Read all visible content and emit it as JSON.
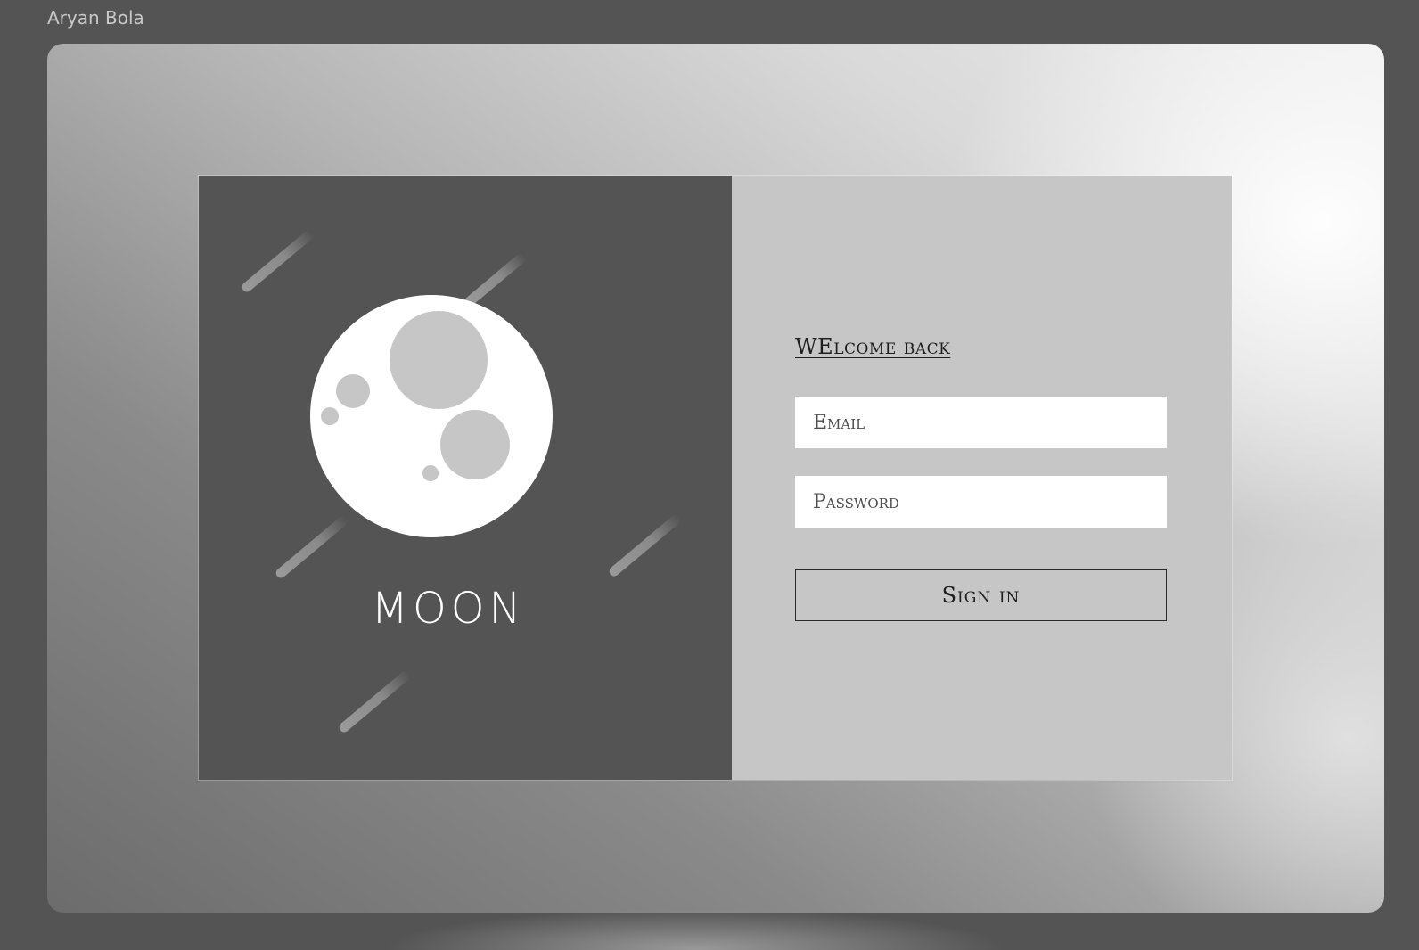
{
  "canvas": {
    "frame_label": "Aryan Bola"
  },
  "brand": {
    "title": "MOON"
  },
  "login": {
    "heading": "WElcome back",
    "email_placeholder": "Email",
    "password_placeholder": "Password",
    "signin_label": "Sign in"
  },
  "colors": {
    "page_background": "#545454",
    "left_panel": "#545454",
    "right_panel": "#c6c6c6",
    "moon": "#ffffff",
    "crater": "#c6c6c6",
    "input_background": "#ffffff",
    "text_dark": "#1e1e1e"
  },
  "icons": {
    "brand_graphic": "moon-illustration",
    "decoration": "shooting-star-streak"
  }
}
